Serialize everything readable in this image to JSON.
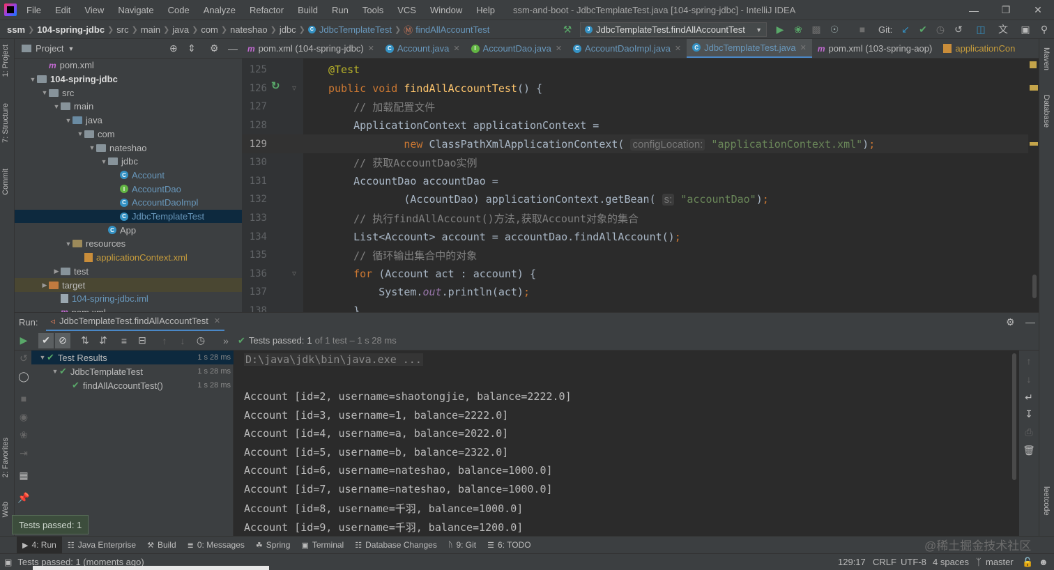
{
  "window": {
    "title": "ssm-and-boot - JdbcTemplateTest.java [104-spring-jdbc] - IntelliJ IDEA",
    "menu": [
      "File",
      "Edit",
      "View",
      "Navigate",
      "Code",
      "Analyze",
      "Refactor",
      "Build",
      "Run",
      "Tools",
      "VCS",
      "Window",
      "Help"
    ]
  },
  "navbar": {
    "breadcrumbs": [
      "ssm",
      "104-spring-jdbc",
      "src",
      "main",
      "java",
      "com",
      "nateshao",
      "jdbc",
      "JdbcTemplateTest",
      "findAllAccountTest"
    ],
    "run_config": "JdbcTemplateTest.findAllAccountTest",
    "git_label": "Git:"
  },
  "sidebar_left": {
    "tabs": [
      "1: Project",
      "7: Structure",
      "Commit",
      "2: Favorites",
      "Web"
    ]
  },
  "sidebar_right": {
    "tabs": [
      "Maven",
      "Database",
      "leetcode"
    ]
  },
  "project": {
    "title": "Project",
    "tree": [
      {
        "label": "pom.xml",
        "kind": "maven",
        "indent": 1,
        "arrow": ""
      },
      {
        "label": "104-spring-jdbc",
        "kind": "module",
        "indent": 0,
        "arrow": "▼"
      },
      {
        "label": "src",
        "kind": "folder",
        "indent": 1,
        "arrow": "▼"
      },
      {
        "label": "main",
        "kind": "folder",
        "indent": 2,
        "arrow": "▼"
      },
      {
        "label": "java",
        "kind": "src",
        "indent": 3,
        "arrow": "▼"
      },
      {
        "label": "com",
        "kind": "folder",
        "indent": 4,
        "arrow": "▼"
      },
      {
        "label": "nateshao",
        "kind": "folder",
        "indent": 5,
        "arrow": "▼"
      },
      {
        "label": "jdbc",
        "kind": "folder",
        "indent": 6,
        "arrow": "▼"
      },
      {
        "label": "Account",
        "kind": "class",
        "indent": 7,
        "arrow": ""
      },
      {
        "label": "AccountDao",
        "kind": "iface",
        "indent": 7,
        "arrow": ""
      },
      {
        "label": "AccountDaoImpl",
        "kind": "class",
        "indent": 7,
        "arrow": ""
      },
      {
        "label": "JdbcTemplateTest",
        "kind": "class",
        "indent": 7,
        "arrow": "",
        "selected": true
      },
      {
        "label": "App",
        "kind": "classplain",
        "indent": 6,
        "arrow": ""
      },
      {
        "label": "resources",
        "kind": "res",
        "indent": 3,
        "arrow": "▼"
      },
      {
        "label": "applicationContext.xml",
        "kind": "xml",
        "indent": 4,
        "arrow": ""
      },
      {
        "label": "test",
        "kind": "folder",
        "indent": 2,
        "arrow": "▶"
      },
      {
        "label": "target",
        "kind": "target",
        "indent": 1,
        "arrow": "▶"
      },
      {
        "label": "104-spring-jdbc.iml",
        "kind": "iml",
        "indent": 2,
        "arrow": ""
      },
      {
        "label": "pom.xml",
        "kind": "maven",
        "indent": 2,
        "arrow": ""
      }
    ]
  },
  "editor_tabs": [
    {
      "label": "pom.xml (104-spring-jdbc)",
      "kind": "maven"
    },
    {
      "label": "Account.java",
      "kind": "class"
    },
    {
      "label": "AccountDao.java",
      "kind": "iface"
    },
    {
      "label": "AccountDaoImpl.java",
      "kind": "class"
    },
    {
      "label": "JdbcTemplateTest.java",
      "kind": "class",
      "active": true
    },
    {
      "label": "pom.xml (103-spring-aop)",
      "kind": "maven"
    },
    {
      "label": "applicationCon",
      "kind": "xml"
    }
  ],
  "editor": {
    "current_line": 129,
    "lines": [
      {
        "n": 125,
        "html": "<span class='ann'>@Test</span>"
      },
      {
        "n": 126,
        "html": "<span class='kw'>public void </span><span class='fn'>findAllAccountTest</span>() {"
      },
      {
        "n": 127,
        "html": "    <span class='cm'>// 加载配置文件</span>"
      },
      {
        "n": 128,
        "html": "    ApplicationContext applicationContext ="
      },
      {
        "n": 129,
        "html": "            <span class='kw'>new </span>ClassPathXmlApplicationContext( <span class='hint'>configLocation:</span> <span class='str'>\"applicationContext.xml\"</span>)<span class='kw'>;</span>"
      },
      {
        "n": 130,
        "html": "    <span class='cm'>// 获取AccountDao实例</span>"
      },
      {
        "n": 131,
        "html": "    AccountDao accountDao ="
      },
      {
        "n": 132,
        "html": "            (AccountDao) applicationContext.getBean( <span class='hint'>s:</span> <span class='str'>\"accountDao\"</span>)<span class='kw'>;</span>"
      },
      {
        "n": 133,
        "html": "    <span class='cm'>// 执行findAllAccount()方法,获取Account对象的集合</span>"
      },
      {
        "n": 134,
        "html": "    List&lt;Account&gt; account = accountDao.findAllAccount()<span class='kw'>;</span>"
      },
      {
        "n": 135,
        "html": "    <span class='cm'>// 循环输出集合中的对象</span>"
      },
      {
        "n": 136,
        "html": "    <span class='kw'>for </span>(Account act : account) {"
      },
      {
        "n": 137,
        "html": "        System.<span class='ital'>out</span>.println(act)<span class='kw'>;</span>"
      },
      {
        "n": 138,
        "html": "    }"
      }
    ]
  },
  "run": {
    "label": "Run:",
    "tab": "JdbcTemplateTest.findAllAccountTest",
    "status_prefix": "Tests passed:",
    "status_count": "1",
    "status_suffix": "of 1 test – 1 s 28 ms",
    "tests": [
      {
        "label": "Test Results",
        "duration": "1 s 28 ms",
        "indent": 0,
        "arrow": "▼",
        "selected": true
      },
      {
        "label": "JdbcTemplateTest",
        "duration": "1 s 28 ms",
        "indent": 1,
        "arrow": "▼"
      },
      {
        "label": "findAllAccountTest()",
        "duration": "1 s 28 ms",
        "indent": 2,
        "arrow": ""
      }
    ],
    "console": [
      "D:\\java\\jdk\\bin\\java.exe ...",
      "",
      "Account [id=2, username=shaotongjie, balance=2222.0]",
      "Account [id=3, username=1, balance=2222.0]",
      "Account [id=4, username=a, balance=2022.0]",
      "Account [id=5, username=b, balance=2322.0]",
      "Account [id=6, username=nateshao, balance=1000.0]",
      "Account [id=7, username=nateshao, balance=1000.0]",
      "Account [id=8, username=千羽, balance=1000.0]",
      "Account [id=9, username=千羽, balance=1200.0]"
    ]
  },
  "tooltip": "Tests passed: 1",
  "bottom_tabs": [
    "4: Run",
    "Java Enterprise",
    "Build",
    "0: Messages",
    "Spring",
    "Terminal",
    "Database Changes",
    "9: Git",
    "6: TODO"
  ],
  "status": {
    "message": "Tests passed: 1 (moments ago)",
    "position": "129:17",
    "line_sep": "CRLF",
    "encoding": "UTF-8",
    "indent": "4 spaces",
    "branch": "master",
    "watermark": "@稀土掘金技术社区"
  }
}
